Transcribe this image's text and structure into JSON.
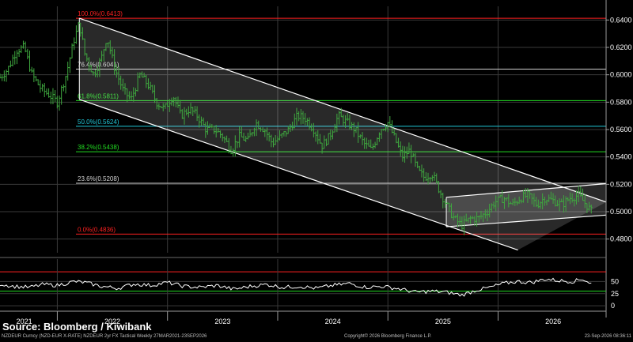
{
  "chart_data": {
    "type": "ohlc",
    "instrument": "NZDEUR",
    "y_axis": {
      "ylim": [
        0.47,
        0.65
      ],
      "tick_values": [
        0.48,
        0.5,
        0.52,
        0.54,
        0.56,
        0.58,
        0.6,
        0.62,
        0.64
      ],
      "tick_labels": [
        "0.4800",
        "0.5000",
        "0.5200",
        "0.5400",
        "0.5600",
        "0.5800",
        "0.6000",
        "0.6200",
        "0.6400"
      ],
      "position": "right"
    },
    "x_axis": {
      "labels": [
        "2021",
        "2022",
        "2023",
        "2024",
        "2025",
        "2026"
      ],
      "label_dates": [
        2021.45,
        2022.25,
        2023.25,
        2024.25,
        2025.25,
        2026.25
      ],
      "divider_dates": [
        2021.75,
        2022.75,
        2023.75,
        2024.75,
        2025.75,
        2026.75
      ],
      "xlim": [
        2021.23,
        2026.73
      ]
    },
    "fibonacci_levels": [
      {
        "label": "100.0%(0.6413)",
        "value": 0.6413,
        "color": "#ff2020"
      },
      {
        "label": "76.4%(0.6041)",
        "value": 0.6041,
        "color": "#d0d0d0"
      },
      {
        "label": "61.8%(0.5811)",
        "value": 0.5811,
        "color": "#22dd22"
      },
      {
        "label": "50.0%(0.5624)",
        "value": 0.5624,
        "color": "#20c8d8"
      },
      {
        "label": "38.2%(0.5438)",
        "value": 0.5438,
        "color": "#22dd22"
      },
      {
        "label": "23.6%(0.5208)",
        "value": 0.5208,
        "color": "#d0d0d0"
      },
      {
        "label": "0.0%(0.4836)",
        "value": 0.4836,
        "color": "#ff2020"
      }
    ],
    "trend_channels": [
      {
        "name": "downtrend-channel",
        "upper": [
          [
            2021.95,
            0.6413
          ],
          [
            2026.73,
            0.507
          ]
        ],
        "lower": [
          [
            2021.95,
            0.582
          ],
          [
            2025.93,
            0.472
          ]
        ]
      },
      {
        "name": "uptrend-channel",
        "upper": [
          [
            2025.28,
            0.5105
          ],
          [
            2026.73,
            0.5205
          ]
        ],
        "lower": [
          [
            2025.28,
            0.489
          ],
          [
            2026.73,
            0.4975
          ]
        ]
      }
    ],
    "weekly_close": [
      [
        2021.23,
        0.598
      ],
      [
        2021.3,
        0.604
      ],
      [
        2021.38,
        0.618
      ],
      [
        2021.45,
        0.62
      ],
      [
        2021.52,
        0.6
      ],
      [
        2021.6,
        0.59
      ],
      [
        2021.68,
        0.585
      ],
      [
        2021.75,
        0.58
      ],
      [
        2021.83,
        0.6
      ],
      [
        2021.9,
        0.625
      ],
      [
        2021.95,
        0.638
      ],
      [
        2022.0,
        0.615
      ],
      [
        2022.08,
        0.6
      ],
      [
        2022.15,
        0.612
      ],
      [
        2022.2,
        0.628
      ],
      [
        2022.27,
        0.605
      ],
      [
        2022.35,
        0.588
      ],
      [
        2022.42,
        0.582
      ],
      [
        2022.5,
        0.6
      ],
      [
        2022.58,
        0.592
      ],
      [
        2022.65,
        0.58
      ],
      [
        2022.72,
        0.575
      ],
      [
        2022.8,
        0.585
      ],
      [
        2022.87,
        0.57
      ],
      [
        2022.95,
        0.575
      ],
      [
        2023.02,
        0.57
      ],
      [
        2023.1,
        0.56
      ],
      [
        2023.18,
        0.56
      ],
      [
        2023.25,
        0.555
      ],
      [
        2023.33,
        0.545
      ],
      [
        2023.4,
        0.555
      ],
      [
        2023.48,
        0.552
      ],
      [
        2023.55,
        0.565
      ],
      [
        2023.63,
        0.56
      ],
      [
        2023.7,
        0.55
      ],
      [
        2023.78,
        0.555
      ],
      [
        2023.85,
        0.56
      ],
      [
        2023.93,
        0.57
      ],
      [
        2024.0,
        0.568
      ],
      [
        2024.08,
        0.56
      ],
      [
        2024.15,
        0.548
      ],
      [
        2024.22,
        0.555
      ],
      [
        2024.3,
        0.57
      ],
      [
        2024.38,
        0.565
      ],
      [
        2024.45,
        0.56
      ],
      [
        2024.53,
        0.55
      ],
      [
        2024.6,
        0.545
      ],
      [
        2024.68,
        0.56
      ],
      [
        2024.75,
        0.565
      ],
      [
        2024.82,
        0.552
      ],
      [
        2024.88,
        0.54
      ],
      [
        2024.95,
        0.545
      ],
      [
        2025.02,
        0.53
      ],
      [
        2025.08,
        0.525
      ],
      [
        2025.15,
        0.528
      ],
      [
        2025.22,
        0.515
      ],
      [
        2025.28,
        0.505
      ],
      [
        2025.35,
        0.495
      ],
      [
        2025.42,
        0.49
      ],
      [
        2025.5,
        0.495
      ],
      [
        2025.57,
        0.495
      ],
      [
        2025.65,
        0.5
      ],
      [
        2025.72,
        0.507
      ],
      [
        2025.8,
        0.51
      ],
      [
        2025.88,
        0.505
      ],
      [
        2025.95,
        0.51
      ],
      [
        2026.02,
        0.512
      ],
      [
        2026.1,
        0.505
      ],
      [
        2026.17,
        0.51
      ],
      [
        2026.25,
        0.508
      ],
      [
        2026.33,
        0.505
      ],
      [
        2026.4,
        0.51
      ],
      [
        2026.48,
        0.512
      ],
      [
        2026.55,
        0.505
      ],
      [
        2026.6,
        0.5
      ]
    ],
    "oscillator": {
      "tick_values": [
        0,
        25,
        50
      ],
      "tick_labels": [
        "0",
        "25",
        "50"
      ],
      "ylim": [
        -8,
        80
      ],
      "reference_lines": [
        {
          "value": 70,
          "color": "#ff2020"
        },
        {
          "value": 30,
          "color": "#22dd22"
        }
      ],
      "values": [
        [
          2021.23,
          45
        ],
        [
          2021.35,
          40
        ],
        [
          2021.5,
          38
        ],
        [
          2021.62,
          44
        ],
        [
          2021.75,
          42
        ],
        [
          2021.9,
          50
        ],
        [
          2022.0,
          48
        ],
        [
          2022.15,
          40
        ],
        [
          2022.3,
          36
        ],
        [
          2022.45,
          45
        ],
        [
          2022.6,
          42
        ],
        [
          2022.75,
          48
        ],
        [
          2022.9,
          40
        ],
        [
          2023.05,
          38
        ],
        [
          2023.2,
          42
        ],
        [
          2023.35,
          34
        ],
        [
          2023.5,
          40
        ],
        [
          2023.65,
          44
        ],
        [
          2023.8,
          38
        ],
        [
          2023.95,
          40
        ],
        [
          2024.1,
          36
        ],
        [
          2024.25,
          42
        ],
        [
          2024.4,
          46
        ],
        [
          2024.55,
          38
        ],
        [
          2024.7,
          40
        ],
        [
          2024.85,
          35
        ],
        [
          2025.0,
          28
        ],
        [
          2025.15,
          30
        ],
        [
          2025.28,
          28
        ],
        [
          2025.42,
          22
        ],
        [
          2025.55,
          32
        ],
        [
          2025.68,
          38
        ],
        [
          2025.8,
          46
        ],
        [
          2025.92,
          50
        ],
        [
          2026.05,
          48
        ],
        [
          2026.18,
          55
        ],
        [
          2026.3,
          52
        ],
        [
          2026.42,
          50
        ],
        [
          2026.52,
          55
        ],
        [
          2026.6,
          45
        ]
      ]
    }
  },
  "source_text": "Source: Bloomberg / Kiwibank",
  "footer": {
    "left": "NZDEUR Curncy (NZD-EUR X-RATE)  NZDEUR 2yr FX Tactical Weekly 27MAR2021-23SEP2026",
    "center": "Copyright© 2026 Bloomberg Finance L.P.",
    "right": "23-Sep-2026 08:36:11"
  },
  "colors": {
    "background": "#000000",
    "bar": "#3fa73f",
    "grid": "#3a3a3a",
    "channel": "#ffffff",
    "axis_text": "#ffffff"
  }
}
